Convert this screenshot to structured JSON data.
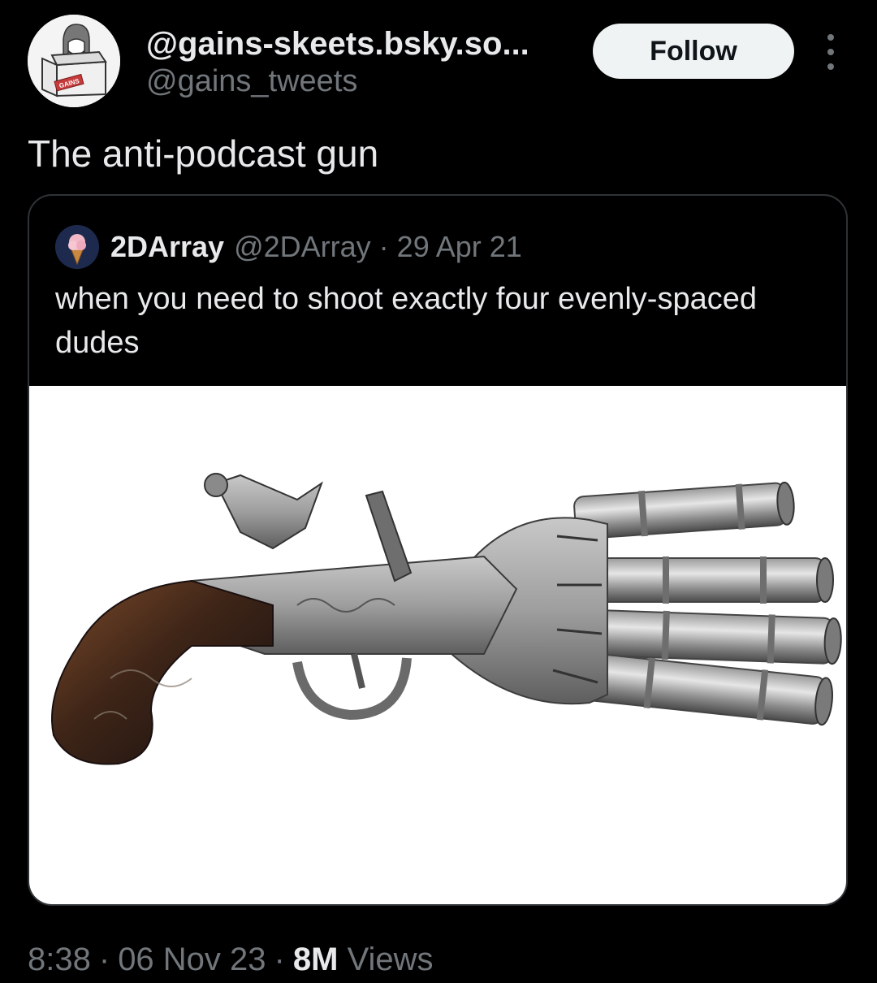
{
  "author": {
    "display_name": "@gains-skeets.bsky.so...",
    "handle": "@gains_tweets",
    "avatar_icon": "profile-avatar-drawing",
    "avatar_box_text": "GAINS"
  },
  "actions": {
    "follow_label": "Follow",
    "more_icon": "more-vertical-icon"
  },
  "tweet": {
    "text": "The anti-podcast gun"
  },
  "quoted_tweet": {
    "display_name": "2DArray",
    "handle": "@2DArray",
    "separator": "·",
    "date": "29 Apr 21",
    "text": "when you need to shoot exactly four evenly-spaced dudes",
    "avatar_icon": "ice-cream-cone-avatar",
    "image_subject": "duck-foot-flintlock-pistol-image"
  },
  "meta": {
    "time": "8:38",
    "separator": "·",
    "date": "06 Nov 23",
    "views_count": "8M",
    "views_label": "Views"
  },
  "colors": {
    "background": "#000000",
    "text_primary": "#e7e9ea",
    "text_secondary": "#71767b",
    "border": "#2f3336",
    "follow_bg": "#eff3f4",
    "follow_text": "#0f1419"
  }
}
